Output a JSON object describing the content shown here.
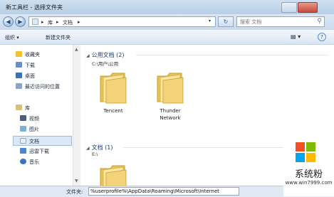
{
  "window": {
    "title": "新工具栏 - 选择文件夹"
  },
  "address": {
    "segments": [
      "库",
      "文档"
    ],
    "separator": "▸",
    "search_placeholder": "搜索 文档"
  },
  "toolbar": {
    "organize": "组织 ▾",
    "new_folder": "新建文件夹"
  },
  "sidebar": {
    "favorites": {
      "label": "收藏夹",
      "items": [
        "下载",
        "桌面",
        "最近访问的位置"
      ]
    },
    "libraries": {
      "label": "库",
      "items": [
        "视频",
        "图片",
        "文档",
        "迅雷下载",
        "音乐"
      ]
    }
  },
  "content": {
    "groups": [
      {
        "header": "公用文档 (2)",
        "path": "C:\\用户\\公用",
        "items": [
          {
            "name": "Tencent"
          },
          {
            "name": "Thunder Network",
            "line1": "Thunder",
            "line2": "Network"
          }
        ]
      },
      {
        "header": "文档 (1)",
        "path": "E:\\"
      }
    ]
  },
  "footer": {
    "label": "文件夹:",
    "value": "%userprofile%\\AppData\\Roaming\\Microsoft\\Internet"
  },
  "watermark": {
    "name": "系统粉",
    "url": "www.win7999.com",
    "logo_colors": [
      "#f25022",
      "#7fba00",
      "#00a4ef",
      "#ffb900"
    ]
  },
  "colors": {
    "accent": "#2a5a96",
    "folder": "#f0c64e"
  }
}
